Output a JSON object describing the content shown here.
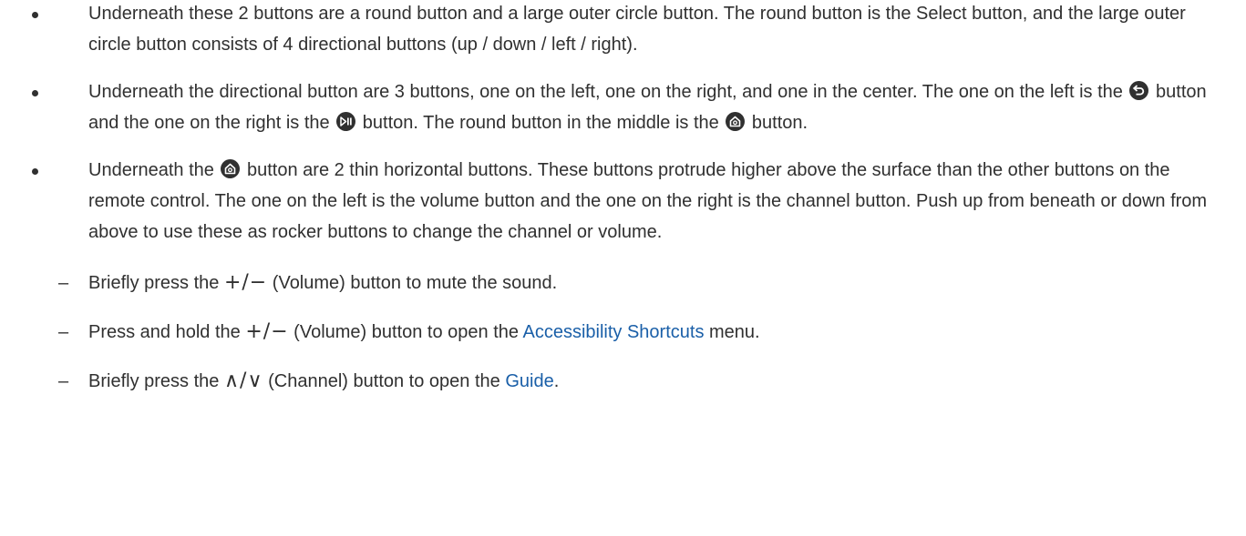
{
  "bullets": [
    {
      "text": "Underneath these 2 buttons are a round button and a large outer circle button. The round button is the Select button, and the large outer circle button consists of 4 directional buttons (up / down / left / right)."
    },
    {
      "part1": "Underneath the directional button are 3 buttons, one on the left, one on the right, and one in the center. The one on the left is the ",
      "part2": " button and the one on the right is the ",
      "part3": " button. The round button in the middle is the ",
      "part4": " button."
    },
    {
      "part1": "Underneath the ",
      "part2": " button are 2 thin horizontal buttons. These buttons protrude higher above the surface than the other buttons on the remote control. The one on the left is the volume button and the one on the right is the channel button. Push up from beneath or down from above to use these as rocker buttons to change the channel or volume."
    }
  ],
  "sub_items": [
    {
      "dash": "–",
      "pre": "Briefly press the ",
      "symbol": "+/−",
      "post": " (Volume) button to mute the sound."
    },
    {
      "dash": "–",
      "pre": "Press and hold the ",
      "symbol": "+/−",
      "mid": " (Volume) button to open the ",
      "link": "Accessibility Shortcuts",
      "post": " menu."
    },
    {
      "dash": "–",
      "pre": "Briefly press the ",
      "symbol": "∧/∨",
      "mid": " (Channel) button to open the ",
      "link": "Guide",
      "post": "."
    }
  ],
  "icons": {
    "return": "return-icon",
    "play_pause": "play-pause-icon",
    "home": "home-icon"
  },
  "colors": {
    "text": "#303030",
    "link": "#1a5fa8"
  }
}
